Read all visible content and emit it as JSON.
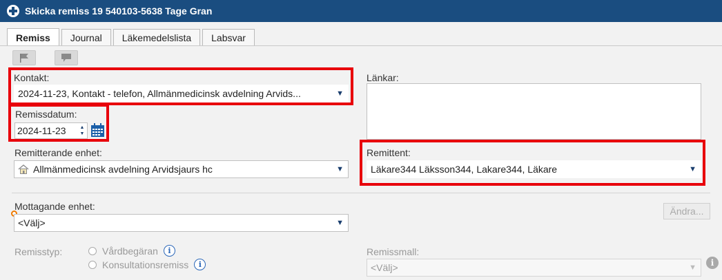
{
  "window": {
    "title": "Skicka remiss 19 540103-5638 Tage Gran"
  },
  "tabs": [
    {
      "label": "Remiss"
    },
    {
      "label": "Journal"
    },
    {
      "label": "Läkemedelslista"
    },
    {
      "label": "Labsvar"
    }
  ],
  "toolbar": {
    "flag_icon": "flag-icon",
    "comment_icon": "comment-icon"
  },
  "form": {
    "kontakt": {
      "label": "Kontakt:",
      "value": "2024-11-23, Kontakt - telefon, Allmänmedicinsk avdelning Arvids..."
    },
    "remissdatum": {
      "label": "Remissdatum:",
      "value": "2024-11-23"
    },
    "lankar": {
      "label": "Länkar:"
    },
    "remitterande_enhet": {
      "label": "Remitterande enhet:",
      "value": "Allmänmedicinsk avdelning Arvidsjaurs hc"
    },
    "remittent": {
      "label": "Remittent:",
      "value": "Läkare344 Läksson344, Lakare344, Läkare"
    },
    "mottagande_enhet": {
      "label": "Mottagande enhet:",
      "value": "<Välj>"
    },
    "andra_button": "Ändra...",
    "remisstyp": {
      "label": "Remisstyp:",
      "options": [
        {
          "label": "Vårdbegäran"
        },
        {
          "label": "Konsultationsremiss"
        }
      ]
    },
    "remissmall": {
      "label": "Remissmall:",
      "value": "<Välj>"
    }
  },
  "colors": {
    "title_bar": "#1a4d80",
    "highlight": "#e8000b",
    "required": "#f07a00"
  }
}
